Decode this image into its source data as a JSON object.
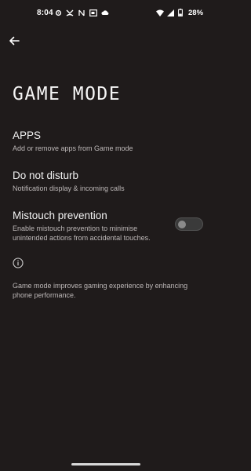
{
  "status_bar": {
    "time": "8:04",
    "left_icons": [
      "gear-icon",
      "missed-call-icon",
      "nfc-icon",
      "cast-icon",
      "cloud-icon"
    ],
    "right_icons": [
      "wifi-icon",
      "signal-icon",
      "battery-icon"
    ],
    "battery": "28%"
  },
  "header": {
    "back_icon": "back-arrow-icon",
    "title": "GAME MODE"
  },
  "settings": {
    "apps": {
      "title": "APPS",
      "subtitle": "Add or remove apps from Game mode"
    },
    "do_not_disturb": {
      "title": "Do not disturb",
      "subtitle": "Notification display & incoming calls"
    },
    "mistouch": {
      "title": "Mistouch prevention",
      "subtitle": "Enable mistouch prevention to minimise unintended actions from accidental touches.",
      "enabled": false
    }
  },
  "info": {
    "icon": "info-icon",
    "text": "Game mode improves gaming experience by enhancing phone performance."
  }
}
